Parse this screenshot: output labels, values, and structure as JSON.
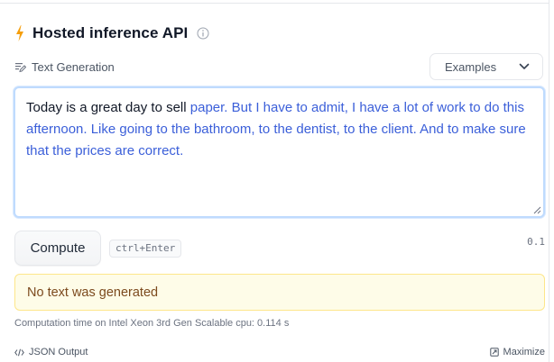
{
  "widget": {
    "title": "Hosted inference API",
    "task_label": "Text Generation",
    "examples_label": "Examples",
    "input": {
      "prompt": "Today is a great day to sell ",
      "generated": "paper. But I have to admit, I have a lot of work to do this afternoon. Like going to the bathroom, to the dentist, to the client. And to make sure that the prices are correct."
    },
    "compute_label": "Compute",
    "shortcut": "ctrl+Enter",
    "version": "0.1",
    "warning": "No text was generated",
    "computation_time": "Computation time on Intel Xeon 3rd Gen Scalable cpu: 0.114 s",
    "json_output_label": "JSON Output",
    "maximize_label": "Maximize"
  },
  "colors": {
    "bolt": "#f59e0b",
    "generated_text": "#3b5fd9",
    "focus_border": "#bfdbfe",
    "warning_bg": "#fefce8",
    "warning_border": "#fde68a",
    "warning_text": "#7c4a1e"
  },
  "icons": {
    "title": "lightning-bolt-icon",
    "info": "info-circle-icon",
    "task": "text-edit-icon",
    "dropdown": "chevron-down-icon",
    "json": "code-brackets-icon",
    "maximize": "maximize-icon"
  }
}
